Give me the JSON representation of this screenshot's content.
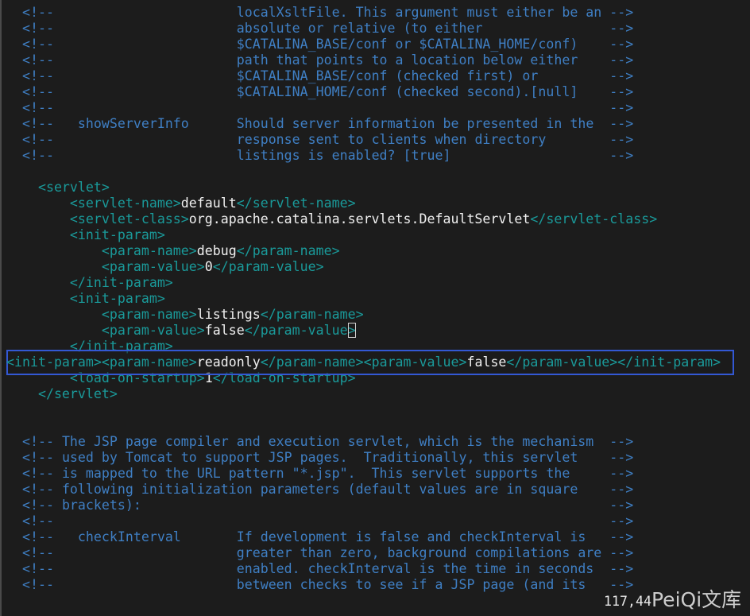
{
  "colors": {
    "background": "#1c1c1c",
    "comment": "#3f7fc4",
    "tag": "#1a9a9a",
    "text": "#f0f0f0",
    "highlight_box": "#3358d4"
  },
  "lines": [
    {
      "kind": "doc",
      "text": "localXsltFile. This argument must either be an"
    },
    {
      "kind": "doc",
      "text": "absolute or relative (to either"
    },
    {
      "kind": "doc",
      "text": "$CATALINA_BASE/conf or $CATALINA_HOME/conf)"
    },
    {
      "kind": "doc",
      "text": "path that points to a location below either"
    },
    {
      "kind": "doc",
      "text": "$CATALINA_BASE/conf (checked first) or"
    },
    {
      "kind": "doc",
      "text": "$CATALINA_HOME/conf (checked second).[null]"
    },
    {
      "kind": "empty"
    },
    {
      "kind": "doc",
      "label": "showServerInfo",
      "text": "Should server information be presented in the"
    },
    {
      "kind": "doc",
      "text": "response sent to clients when directory"
    },
    {
      "kind": "doc",
      "text": "listings is enabled? [true]"
    },
    {
      "kind": "blank"
    },
    {
      "kind": "xml",
      "parts": [
        [
          "tag",
          "    <servlet>"
        ]
      ]
    },
    {
      "kind": "xml",
      "parts": [
        [
          "tag",
          "        <servlet-name>"
        ],
        [
          "txt",
          "default"
        ],
        [
          "tag",
          "</servlet-name>"
        ]
      ]
    },
    {
      "kind": "xml",
      "parts": [
        [
          "tag",
          "        <servlet-class>"
        ],
        [
          "txt",
          "org.apache.catalina.servlets.DefaultServlet"
        ],
        [
          "tag",
          "</servlet-class>"
        ]
      ]
    },
    {
      "kind": "xml",
      "parts": [
        [
          "tag",
          "        <init-param>"
        ]
      ]
    },
    {
      "kind": "xml",
      "parts": [
        [
          "tag",
          "            <param-name>"
        ],
        [
          "txt",
          "debug"
        ],
        [
          "tag",
          "</param-name>"
        ]
      ]
    },
    {
      "kind": "xml",
      "parts": [
        [
          "tag",
          "            <param-value>"
        ],
        [
          "txt",
          "0"
        ],
        [
          "tag",
          "</param-value>"
        ]
      ]
    },
    {
      "kind": "xml",
      "parts": [
        [
          "tag",
          "        </init-param>"
        ]
      ]
    },
    {
      "kind": "xml",
      "parts": [
        [
          "tag",
          "        <init-param>"
        ]
      ]
    },
    {
      "kind": "xml",
      "parts": [
        [
          "tag",
          "            <param-name>"
        ],
        [
          "txt",
          "listings"
        ],
        [
          "tag",
          "</param-name>"
        ]
      ]
    },
    {
      "kind": "xml",
      "parts": [
        [
          "tag",
          "            <param-value>"
        ],
        [
          "txt",
          "false"
        ],
        [
          "tag",
          "</param-value"
        ],
        [
          "cursor",
          ">"
        ]
      ]
    },
    {
      "kind": "xml",
      "parts": [
        [
          "tag",
          "        </init-param>"
        ]
      ]
    },
    {
      "kind": "xml",
      "highlight": true,
      "parts": [
        [
          "tag",
          "<init-param><param-name>"
        ],
        [
          "txt",
          "readonly"
        ],
        [
          "tag",
          "</param-name><param-value>"
        ],
        [
          "txt",
          "false"
        ],
        [
          "tag",
          "</param-value></init-param>"
        ]
      ]
    },
    {
      "kind": "xml",
      "parts": [
        [
          "tag",
          "        <load-on-startup>"
        ],
        [
          "txt",
          "1"
        ],
        [
          "tag",
          "</load-on-startup>"
        ]
      ]
    },
    {
      "kind": "xml",
      "parts": [
        [
          "tag",
          "    </servlet>"
        ]
      ]
    },
    {
      "kind": "blank"
    },
    {
      "kind": "blank"
    },
    {
      "kind": "intro",
      "text": "The JSP page compiler and execution servlet, which is the mechanism"
    },
    {
      "kind": "intro",
      "text": "used by Tomcat to support JSP pages.  Traditionally, this servlet"
    },
    {
      "kind": "intro",
      "text": "is mapped to the URL pattern \"*.jsp\".  This servlet supports the"
    },
    {
      "kind": "intro",
      "text": "following initialization parameters (default values are in square"
    },
    {
      "kind": "intro",
      "text": "brackets):"
    },
    {
      "kind": "empty"
    },
    {
      "kind": "doc",
      "label": "checkInterval",
      "text": "If development is false and checkInterval is"
    },
    {
      "kind": "doc",
      "text": "greater than zero, background compilations are"
    },
    {
      "kind": "doc",
      "text": "enabled. checkInterval is the time in seconds"
    },
    {
      "kind": "doc",
      "text": "between checks to see if a JSP page (and its"
    }
  ],
  "status": {
    "cursor_position": "117,44"
  },
  "watermark": "PeiQi文库"
}
